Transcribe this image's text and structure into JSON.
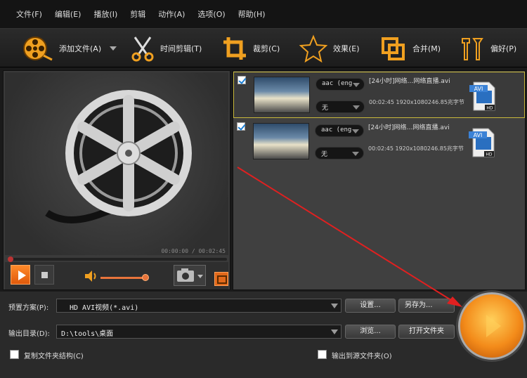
{
  "menu": [
    "文件(F)",
    "编辑(E)",
    "播放(I)",
    "剪辑",
    "动作(A)",
    "选项(O)",
    "帮助(H)"
  ],
  "toolbar": {
    "add_file": "添加文件(A)",
    "trim": "时间剪辑(T)",
    "crop": "裁剪(C)",
    "effect": "效果(E)",
    "merge": "合并(M)",
    "prefs": "偏好(P)"
  },
  "player": {
    "time": "00:00:00 / 00:02:45"
  },
  "files": [
    {
      "audio": "aac (eng",
      "subtitle": "无",
      "name": "[24小时]网络…网络直播.avi",
      "info": "00:02:45 1920x1080246.85兆字节",
      "format": "AVI"
    },
    {
      "audio": "aac (eng",
      "subtitle": "无",
      "name": "[24小时]网络…网络直播.avi",
      "info": "00:02:45 1920x1080246.85兆字节",
      "format": "AVI"
    }
  ],
  "bottom": {
    "preset_label": "预置方案(P):",
    "preset_value": "HD AVI视频(*.avi)",
    "settings": "设置...",
    "save_as": "另存为...",
    "output_label": "输出目录(D):",
    "output_value": "D:\\tools\\桌面",
    "browse": "浏览...",
    "open_folder": "打开文件夹",
    "copy_structure": "复制文件夹结构(C)",
    "output_to_source": "输出到源文件夹(O)"
  },
  "colors": {
    "accent": "#f07a1a",
    "selection": "#c9b93c",
    "arrow": "#e02020"
  }
}
